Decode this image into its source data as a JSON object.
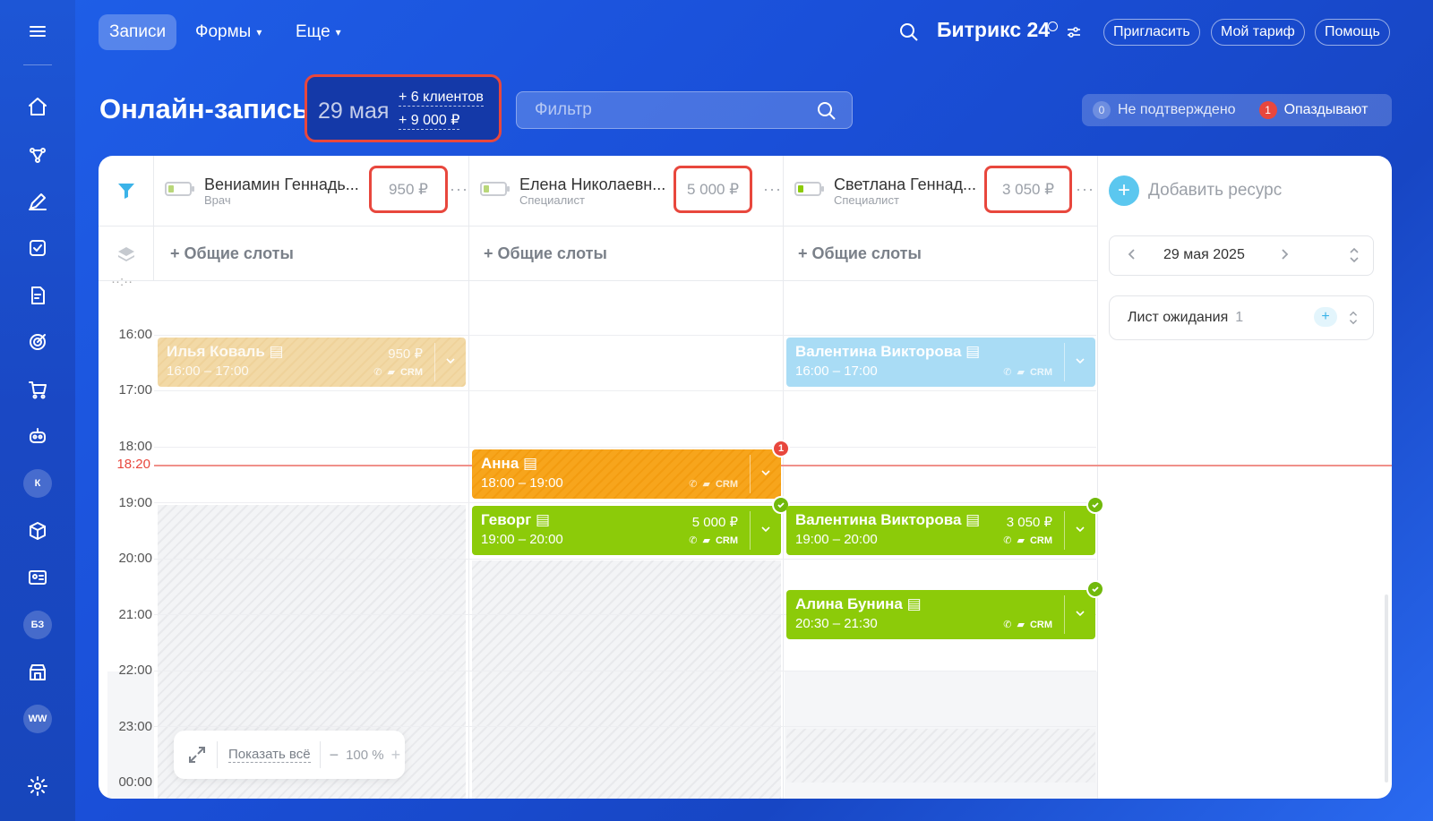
{
  "topnav": {
    "items": [
      {
        "label": "Записи",
        "active": true
      },
      {
        "label": "Формы",
        "active": false
      },
      {
        "label": "Еще",
        "active": false
      }
    ],
    "brand": "Битрикс",
    "brand_num": "24",
    "buttons": {
      "invite": "Пригласить",
      "tariff": "Мой тариф",
      "help": "Помощь"
    }
  },
  "sidebar": {
    "icons": [
      "home-icon",
      "crm-icon",
      "pen-icon",
      "tasks-icon",
      "docs-icon",
      "target-icon",
      "cart-icon",
      "robot-icon",
      "avatar-k",
      "box-icon",
      "contacts-icon",
      "avatar-bz",
      "store-icon",
      "avatar-ww",
      "settings-icon"
    ],
    "avatars": {
      "k": "К",
      "bz": "БЗ",
      "ww": "WW"
    }
  },
  "header": {
    "title": "Онлайн-запись",
    "date": "29 мая",
    "clients": "+ 6 клиентов",
    "money": "+ 9 000 ₽",
    "filter_placeholder": "Фильтр",
    "unconfirmed_count": "0",
    "unconfirmed_label": "Не подтверждено",
    "late_count": "1",
    "late_label": "Опаздывают"
  },
  "resources": [
    {
      "name": "Вениамин Геннадь...",
      "role": "Врач",
      "price": "950 ₽"
    },
    {
      "name": "Елена Николаевн...",
      "role": "Специалист",
      "price": "5 000 ₽"
    },
    {
      "name": "Светлана Геннад...",
      "role": "Специалист",
      "price": "3 050 ₽"
    }
  ],
  "common_slots": "+ Общие слоты",
  "add_resource": "Добавить ресурс",
  "date_nav": "29 мая 2025",
  "waitlist": {
    "label": "Лист ожидания",
    "count": "1"
  },
  "times": [
    "16:00",
    "17:00",
    "18:00",
    "19:00",
    "20:00",
    "21:00",
    "22:00",
    "23:00",
    "00:00"
  ],
  "now": "18:20",
  "crm": "CRM",
  "events": [
    {
      "name": "Илья Коваль",
      "time": "16:00 – 17:00",
      "price": "950 ₽"
    },
    {
      "name": "Валентина Викторова",
      "time": "16:00 – 17:00",
      "price": ""
    },
    {
      "name": "Анна",
      "time": "18:00 – 19:00",
      "price": "",
      "badge": "1"
    },
    {
      "name": "Геворг",
      "time": "19:00 – 20:00",
      "price": "5 000 ₽"
    },
    {
      "name": "Валентина Викторова",
      "time": "19:00 – 20:00",
      "price": "3 050 ₽"
    },
    {
      "name": "Алина Бунина",
      "time": "20:30 – 21:30",
      "price": ""
    }
  ],
  "zoom": {
    "show_all": "Показать всё",
    "level": "100 %"
  }
}
